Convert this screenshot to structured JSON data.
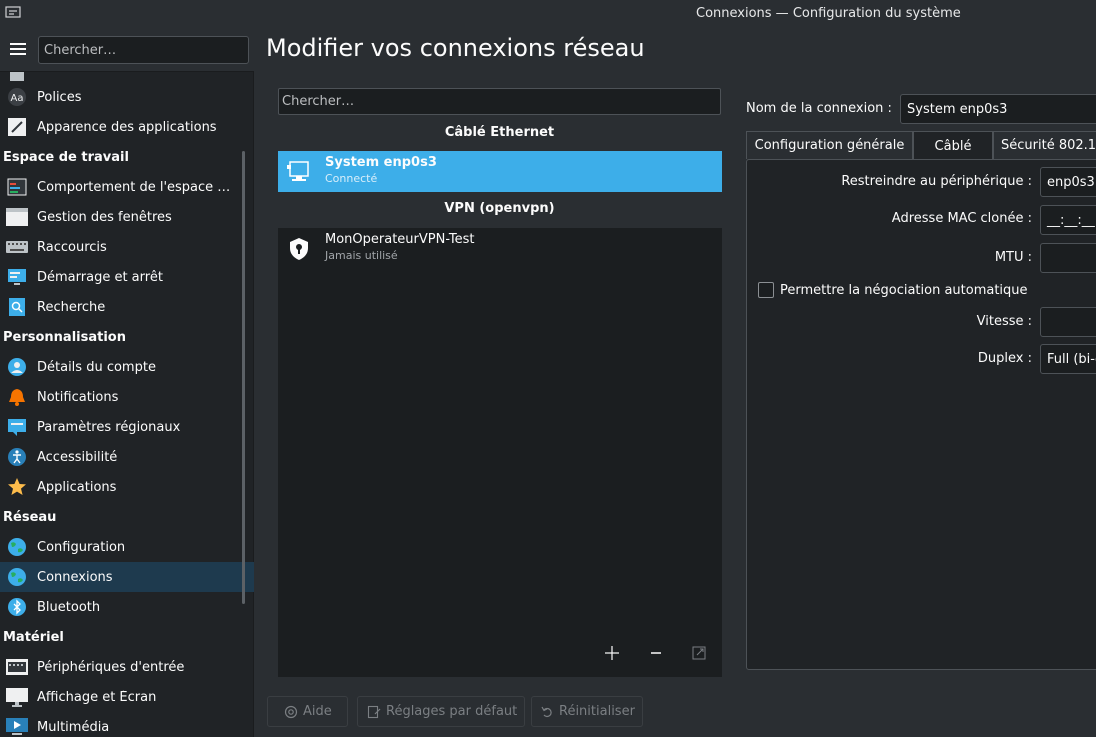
{
  "window": {
    "title": "Connexions — Configuration du système"
  },
  "sidebar": {
    "search_placeholder": "Chercher…",
    "items": [
      {
        "type": "item",
        "label": "Polices",
        "icon": "fonts-icon"
      },
      {
        "type": "item",
        "label": "Apparence des applications",
        "icon": "appearance-icon"
      },
      {
        "type": "category",
        "label": "Espace de travail"
      },
      {
        "type": "item",
        "label": "Comportement de l'espace …",
        "icon": "workspace-behavior-icon"
      },
      {
        "type": "item",
        "label": "Gestion des fenêtres",
        "icon": "window-management-icon"
      },
      {
        "type": "item",
        "label": "Raccourcis",
        "icon": "keyboard-icon"
      },
      {
        "type": "item",
        "label": "Démarrage et arrêt",
        "icon": "startup-shutdown-icon"
      },
      {
        "type": "item",
        "label": "Recherche",
        "icon": "search-icon"
      },
      {
        "type": "category",
        "label": "Personnalisation"
      },
      {
        "type": "item",
        "label": "Détails du compte",
        "icon": "user-account-icon"
      },
      {
        "type": "item",
        "label": "Notifications",
        "icon": "bell-icon"
      },
      {
        "type": "item",
        "label": "Paramètres régionaux",
        "icon": "regional-settings-icon"
      },
      {
        "type": "item",
        "label": "Accessibilité",
        "icon": "accessibility-icon"
      },
      {
        "type": "item",
        "label": "Applications",
        "icon": "star-icon"
      },
      {
        "type": "category",
        "label": "Réseau"
      },
      {
        "type": "item",
        "label": "Configuration",
        "icon": "globe-icon"
      },
      {
        "type": "item",
        "label": "Connexions",
        "icon": "globe-icon",
        "selected": true
      },
      {
        "type": "item",
        "label": "Bluetooth",
        "icon": "bluetooth-icon"
      },
      {
        "type": "category",
        "label": "Matériel"
      },
      {
        "type": "item",
        "label": "Périphériques d'entrée",
        "icon": "input-devices-icon"
      },
      {
        "type": "item",
        "label": "Affichage et Écran",
        "icon": "display-icon"
      },
      {
        "type": "item",
        "label": "Multimédia",
        "icon": "multimedia-icon"
      }
    ]
  },
  "main": {
    "title": "Modifier vos connexions réseau",
    "search_placeholder": "Chercher…",
    "wired_header": "Câblé Ethernet",
    "wired_connection": {
      "name": "System enp0s3",
      "status": "Connecté"
    },
    "vpn_header": "VPN (openvpn)",
    "vpn_connection": {
      "name": "MonOperateurVPN-Test",
      "status": "Jamais utilisé"
    }
  },
  "details": {
    "connection_name_label": "Nom de la connexion :",
    "connection_name_value": "System enp0s3",
    "tabs": [
      "Configuration générale",
      "Câblé",
      "Sécurité 802.1"
    ],
    "active_tab": "Câblé",
    "restrict_label": "Restreindre au périphérique :",
    "restrict_value": "enp0s3",
    "mac_label": "Adresse MAC clonée :",
    "mac_value": "__:__:__",
    "mtu_label": "MTU :",
    "mtu_value": "",
    "autoneg_label": "Permettre la négociation automatique",
    "autoneg_checked": false,
    "speed_label": "Vitesse :",
    "speed_value": "",
    "duplex_label": "Duplex :",
    "duplex_value": "Full (bi-d"
  },
  "footer": {
    "help": "Aide",
    "defaults": "Réglages par défaut",
    "reset": "Réinitialiser"
  },
  "colors": {
    "accent": "#3daee9",
    "background": "#2a2e32",
    "sidebar": "#202326",
    "selection": "#1e3a4e"
  }
}
